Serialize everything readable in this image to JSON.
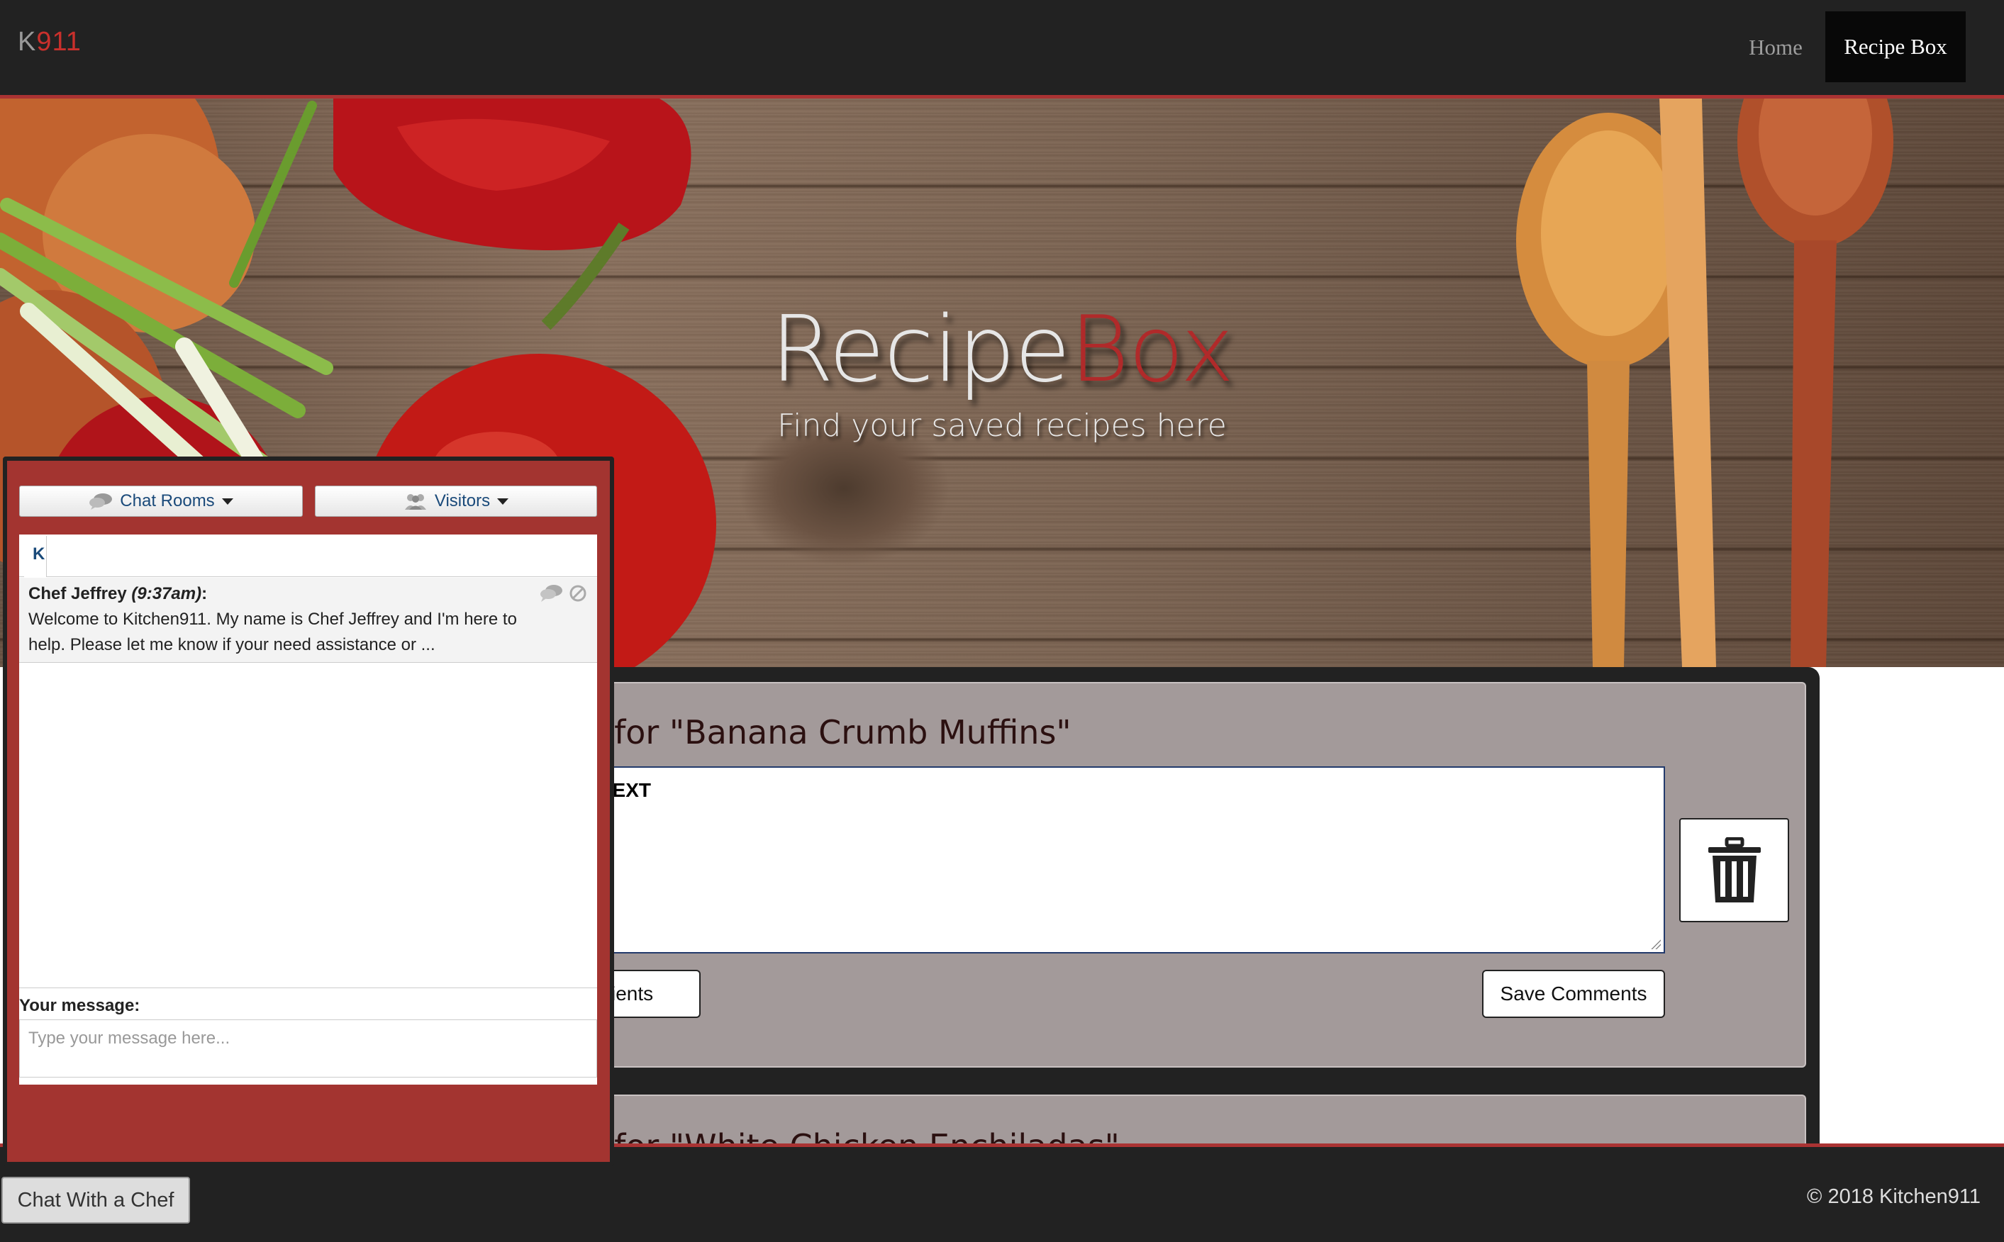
{
  "navbar": {
    "brand_k": "K",
    "brand_num": "911",
    "home_label": "Home",
    "recipe_box_label": "Recipe Box"
  },
  "hero": {
    "title_part1": "Recipe",
    "title_part2": "Box",
    "subtitle": "Find your saved recipes here"
  },
  "comments": {
    "card1_title": "ents for \"Banana Crumb Muffins\"",
    "card1_text": "E TEXT",
    "ingredients_label": "ients",
    "save_label": "Save Comments",
    "card2_title": "ents for \"White Chicken Enchiladas\""
  },
  "chat": {
    "chat_rooms_label": "Chat Rooms",
    "visitors_label": "Visitors",
    "tab_label": "K",
    "message": {
      "author": "Chef Jeffrey",
      "time": "(9:37am)",
      "colon": ":",
      "line1": "Welcome to Kitchen911. My name is Chef Jeffrey and I'm here to",
      "line2": "help. Please let me know if your need assistance or ..."
    },
    "your_message_label": "Your message:",
    "input_placeholder": "Type your message here..."
  },
  "footer": {
    "chat_button_label": "Chat With a Chef",
    "copyright": "© 2018 Kitchen911"
  },
  "colors": {
    "accent_red": "#a33430",
    "brand_red": "#c9302c",
    "navbar_bg": "#222222",
    "card_bg": "#a39a9a"
  }
}
